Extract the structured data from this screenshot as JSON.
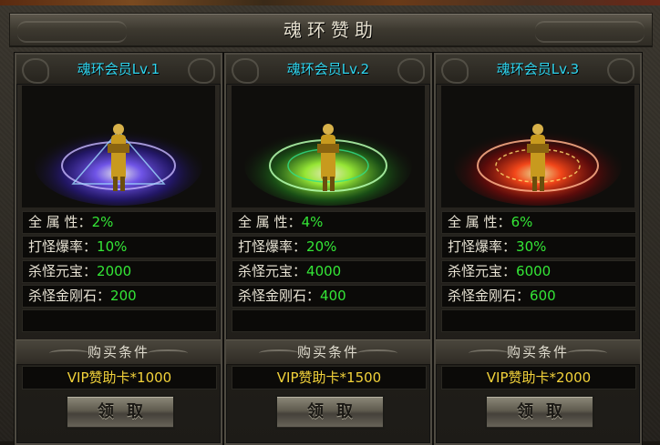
{
  "window": {
    "title": "魂环赞助"
  },
  "cards": [
    {
      "title": "魂环会员Lv.1",
      "ring_color": "#6a4cff",
      "stats": [
        {
          "label": "全 属 性",
          "value": "2%"
        },
        {
          "label": "打怪爆率",
          "value": "10%"
        },
        {
          "label": "杀怪元宝",
          "value": "2000"
        },
        {
          "label": "杀怪金刚石",
          "value": "200"
        }
      ],
      "condition_label": "购买条件",
      "condition_value": "VIP赞助卡*1000",
      "button_label": "领取"
    },
    {
      "title": "魂环会员Lv.2",
      "ring_color": "#9aff2a",
      "stats": [
        {
          "label": "全 属 性",
          "value": "4%"
        },
        {
          "label": "打怪爆率",
          "value": "20%"
        },
        {
          "label": "杀怪元宝",
          "value": "4000"
        },
        {
          "label": "杀怪金刚石",
          "value": "400"
        }
      ],
      "condition_label": "购买条件",
      "condition_value": "VIP赞助卡*1500",
      "button_label": "领取"
    },
    {
      "title": "魂环会员Lv.3",
      "ring_color": "#ff3a14",
      "stats": [
        {
          "label": "全 属 性",
          "value": "6%"
        },
        {
          "label": "打怪爆率",
          "value": "30%"
        },
        {
          "label": "杀怪元宝",
          "value": "6000"
        },
        {
          "label": "杀怪金刚石",
          "value": "600"
        }
      ],
      "condition_label": "购买条件",
      "condition_value": "VIP赞助卡*2000",
      "button_label": "领取"
    }
  ]
}
